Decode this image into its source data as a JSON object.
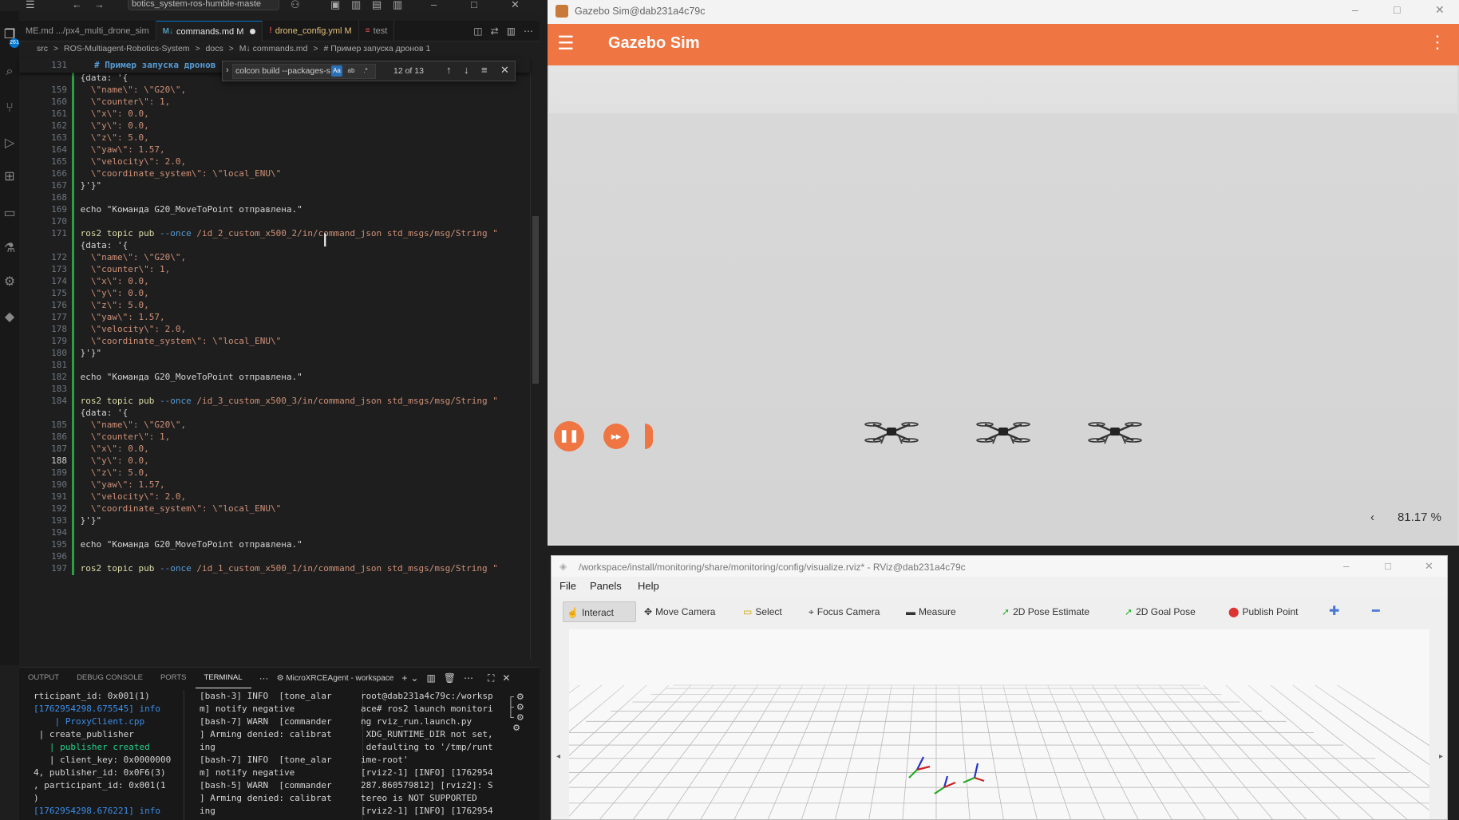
{
  "vscode": {
    "title_search": "botics_system-ros-humble-maste",
    "activity_badge": "261",
    "tabs": [
      {
        "icon": "M↓",
        "label": "ME.md .../px4_multi_drone_sim",
        "active": false
      },
      {
        "icon": "M↓",
        "label": "commands.md M",
        "active": true,
        "dirty": true
      },
      {
        "icon": "!",
        "label": "drone_config.yml M",
        "active": false
      },
      {
        "icon": "≡",
        "label": "test",
        "active": false
      }
    ],
    "breadcrumb": [
      "src",
      ">",
      "ROS-Multiagent-Robotics-System",
      ">",
      "docs",
      ">",
      "M↓ commands.md",
      ">",
      "# Пример запуска дронов 1"
    ],
    "sticky": {
      "line": "131",
      "text": "# Пример запуска дронов"
    },
    "find": {
      "query": "colcon build --packages-s",
      "case_opt": "Aa",
      "word_opt": "ab",
      "regex_opt": ".*",
      "count": "12 of 13"
    },
    "lines": [
      {
        "n": "",
        "t": " {data: '{"
      },
      {
        "n": "159",
        "t": "   \\\"name\\\": \\\"G20\\\","
      },
      {
        "n": "160",
        "t": "   \\\"counter\\\": 1,"
      },
      {
        "n": "161",
        "t": "   \\\"x\\\": 0.0,"
      },
      {
        "n": "162",
        "t": "   \\\"y\\\": 0.0,"
      },
      {
        "n": "163",
        "t": "   \\\"z\\\": 5.0,"
      },
      {
        "n": "164",
        "t": "   \\\"yaw\\\": 1.57,"
      },
      {
        "n": "165",
        "t": "   \\\"velocity\\\": 2.0,"
      },
      {
        "n": "166",
        "t": "   \\\"coordinate_system\\\": \\\"local_ENU\\\""
      },
      {
        "n": "167",
        "t": " }'}\""
      },
      {
        "n": "168",
        "t": ""
      },
      {
        "n": "169",
        "t": " echo \"Команда G20_MoveToPoint отправлена.\""
      },
      {
        "n": "170",
        "t": ""
      },
      {
        "n": "171",
        "ros": " ros2 topic pub",
        "flag": " --once",
        "rest": " /id_2_custom_x500_2/in/command_json std_msgs/msg/String \""
      },
      {
        "n": "",
        "t": " {data: '{"
      },
      {
        "n": "172",
        "t": "   \\\"name\\\": \\\"G20\\\","
      },
      {
        "n": "173",
        "t": "   \\\"counter\\\": 1,"
      },
      {
        "n": "174",
        "t": "   \\\"x\\\": 0.0,"
      },
      {
        "n": "175",
        "t": "   \\\"y\\\": 0.0,"
      },
      {
        "n": "176",
        "t": "   \\\"z\\\": 5.0,"
      },
      {
        "n": "177",
        "t": "   \\\"yaw\\\": 1.57,"
      },
      {
        "n": "178",
        "t": "   \\\"velocity\\\": 2.0,"
      },
      {
        "n": "179",
        "t": "   \\\"coordinate_system\\\": \\\"local_ENU\\\""
      },
      {
        "n": "180",
        "t": " }'}\""
      },
      {
        "n": "181",
        "t": ""
      },
      {
        "n": "182",
        "t": " echo \"Команда G20_MoveToPoint отправлена.\""
      },
      {
        "n": "183",
        "t": ""
      },
      {
        "n": "184",
        "ros": " ros2 topic pub",
        "flag": " --once",
        "rest": " /id_3_custom_x500_3/in/command_json std_msgs/msg/String \""
      },
      {
        "n": "",
        "t": " {data: '{"
      },
      {
        "n": "185",
        "t": "   \\\"name\\\": \\\"G20\\\","
      },
      {
        "n": "186",
        "t": "   \\\"counter\\\": 1,"
      },
      {
        "n": "187",
        "t": "   \\\"x\\\": 0.0,"
      },
      {
        "n": "188",
        "t": "   \\\"y\\\": 0.0,",
        "cur": true
      },
      {
        "n": "189",
        "t": "   \\\"z\\\": 5.0,"
      },
      {
        "n": "190",
        "t": "   \\\"yaw\\\": 1.57,"
      },
      {
        "n": "191",
        "t": "   \\\"velocity\\\": 2.0,"
      },
      {
        "n": "192",
        "t": "   \\\"coordinate_system\\\": \\\"local_ENU\\\""
      },
      {
        "n": "193",
        "t": " }'}\""
      },
      {
        "n": "194",
        "t": ""
      },
      {
        "n": "195",
        "t": " echo \"Команда G20_MoveToPoint отправлена.\""
      },
      {
        "n": "196",
        "t": ""
      },
      {
        "n": "197",
        "ros": " ros2 topic pub",
        "flag": " --once",
        "rest": " /id_1_custom_x500_1/in/command_json std_msgs/msg/String \""
      }
    ],
    "panel": {
      "tabs": [
        "OUTPUT",
        "DEBUG CONSOLE",
        "PORTS",
        "TERMINAL"
      ],
      "active_tab": "TERMINAL",
      "more": "···",
      "terminal_selector": "MicroXRCEAgent - workspace",
      "term1": [
        {
          "c": "",
          "t": "rticipant_id: 0x001(1)"
        },
        {
          "c": "cy",
          "t": "[1762954298.675545] info"
        },
        {
          "c": "cy",
          "t": "    | ProxyClient.cpp"
        },
        {
          "c": "",
          "t": " | create_publisher"
        },
        {
          "c": "gr",
          "t": "   | publisher created"
        },
        {
          "c": "",
          "t": "   | client_key: 0x0000000"
        },
        {
          "c": "",
          "t": "4, publisher_id: 0x0F6(3)"
        },
        {
          "c": "",
          "t": ", participant_id: 0x001(1"
        },
        {
          "c": "",
          "t": ")"
        },
        {
          "c": "cy",
          "t": "[1762954298.676221] info"
        }
      ],
      "term2": [
        "[bash-3] INFO  [tone_alar",
        "m] notify negative",
        "[bash-7] WARN  [commander",
        "] Arming denied: calibrat",
        "ing",
        "[bash-7] INFO  [tone_alar",
        "m] notify negative",
        "[bash-5] WARN  [commander",
        "] Arming denied: calibrat",
        "ing"
      ],
      "term3": [
        "root@dab231a4c79c:/worksp",
        "ace# ros2 launch monitori",
        "ng rviz_run.launch.py",
        " XDG_RUNTIME_DIR not set,",
        " defaulting to '/tmp/runt",
        "ime-root'",
        "[rviz2-1] [INFO] [1762954",
        "287.860579812] [rviz2]: S",
        "tereo is NOT SUPPORTED",
        "[rviz2-1] [INFO] [1762954"
      ]
    }
  },
  "gazebo": {
    "window_title": "Gazebo Sim@dab231a4c79c",
    "app_title": "Gazebo Sim",
    "rtf": "81.17 %",
    "accent": "#ef7542"
  },
  "rviz": {
    "window_title": "/workspace/install/monitoring/share/monitoring/config/visualize.rviz* - RViz@dab231a4c79c",
    "menu": [
      "File",
      "Panels",
      "Help"
    ],
    "tools": [
      {
        "icon": "hand-icon",
        "label": "Interact",
        "active": true
      },
      {
        "icon": "move-camera-icon",
        "label": "Move Camera"
      },
      {
        "icon": "select-icon",
        "label": "Select"
      },
      {
        "icon": "focus-camera-icon",
        "label": "Focus Camera"
      },
      {
        "icon": "measure-icon",
        "label": "Measure"
      },
      {
        "icon": "pose-estimate-icon",
        "label": "2D Pose Estimate"
      },
      {
        "icon": "goal-pose-icon",
        "label": "2D Goal Pose"
      },
      {
        "icon": "publish-point-icon",
        "label": "Publish Point"
      }
    ]
  }
}
